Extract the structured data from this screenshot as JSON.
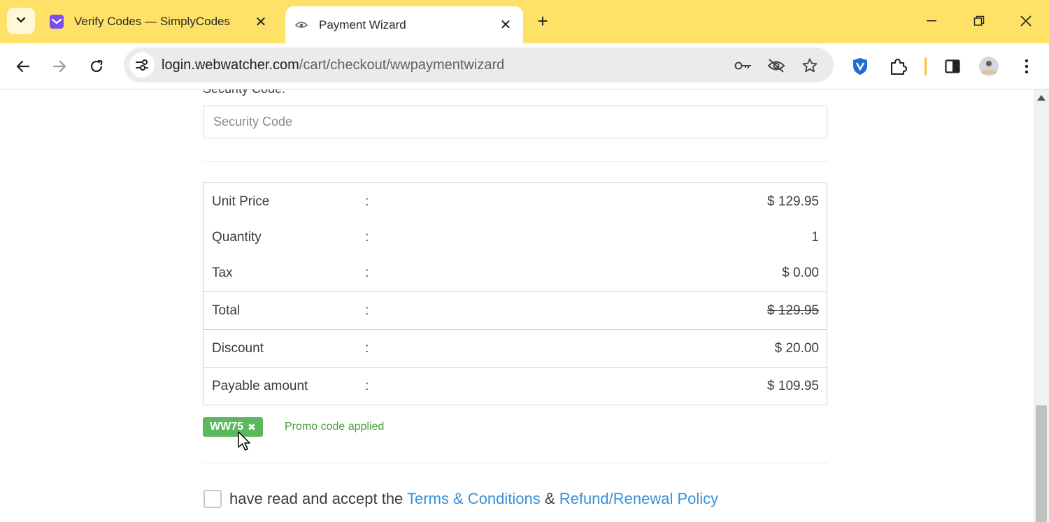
{
  "browser": {
    "tabs": [
      {
        "title": "Verify Codes — SimplyCodes",
        "active": false
      },
      {
        "title": "Payment Wizard",
        "active": true
      }
    ],
    "url_host": "login.webwatcher.com",
    "url_path": "/cart/checkout/wwpaymentwizard",
    "accent_color": "#fde267"
  },
  "form": {
    "security_label": "Security Code:",
    "security_placeholder": "Security Code"
  },
  "summary": {
    "colon": ":",
    "rows": [
      {
        "label": "Unit Price",
        "value": "$ 129.95"
      },
      {
        "label": "Quantity",
        "value": "1"
      },
      {
        "label": "Tax",
        "value": "$ 0.00"
      },
      {
        "label": "Total",
        "value": "$ 129.95",
        "struck": true
      },
      {
        "label": "Discount",
        "value": "$ 20.00"
      },
      {
        "label": "Payable amount",
        "value": "$ 109.95"
      }
    ]
  },
  "promo": {
    "code": "WW75",
    "remove_glyph": "✖",
    "message": "Promo code applied",
    "badge_color": "#5cb85c"
  },
  "agreement": {
    "text": "have read and accept the",
    "terms_link": "Terms & Conditions",
    "joiner": "&",
    "refund_link": "Refund/Renewal Policy",
    "link_color": "#3a8fd6"
  }
}
